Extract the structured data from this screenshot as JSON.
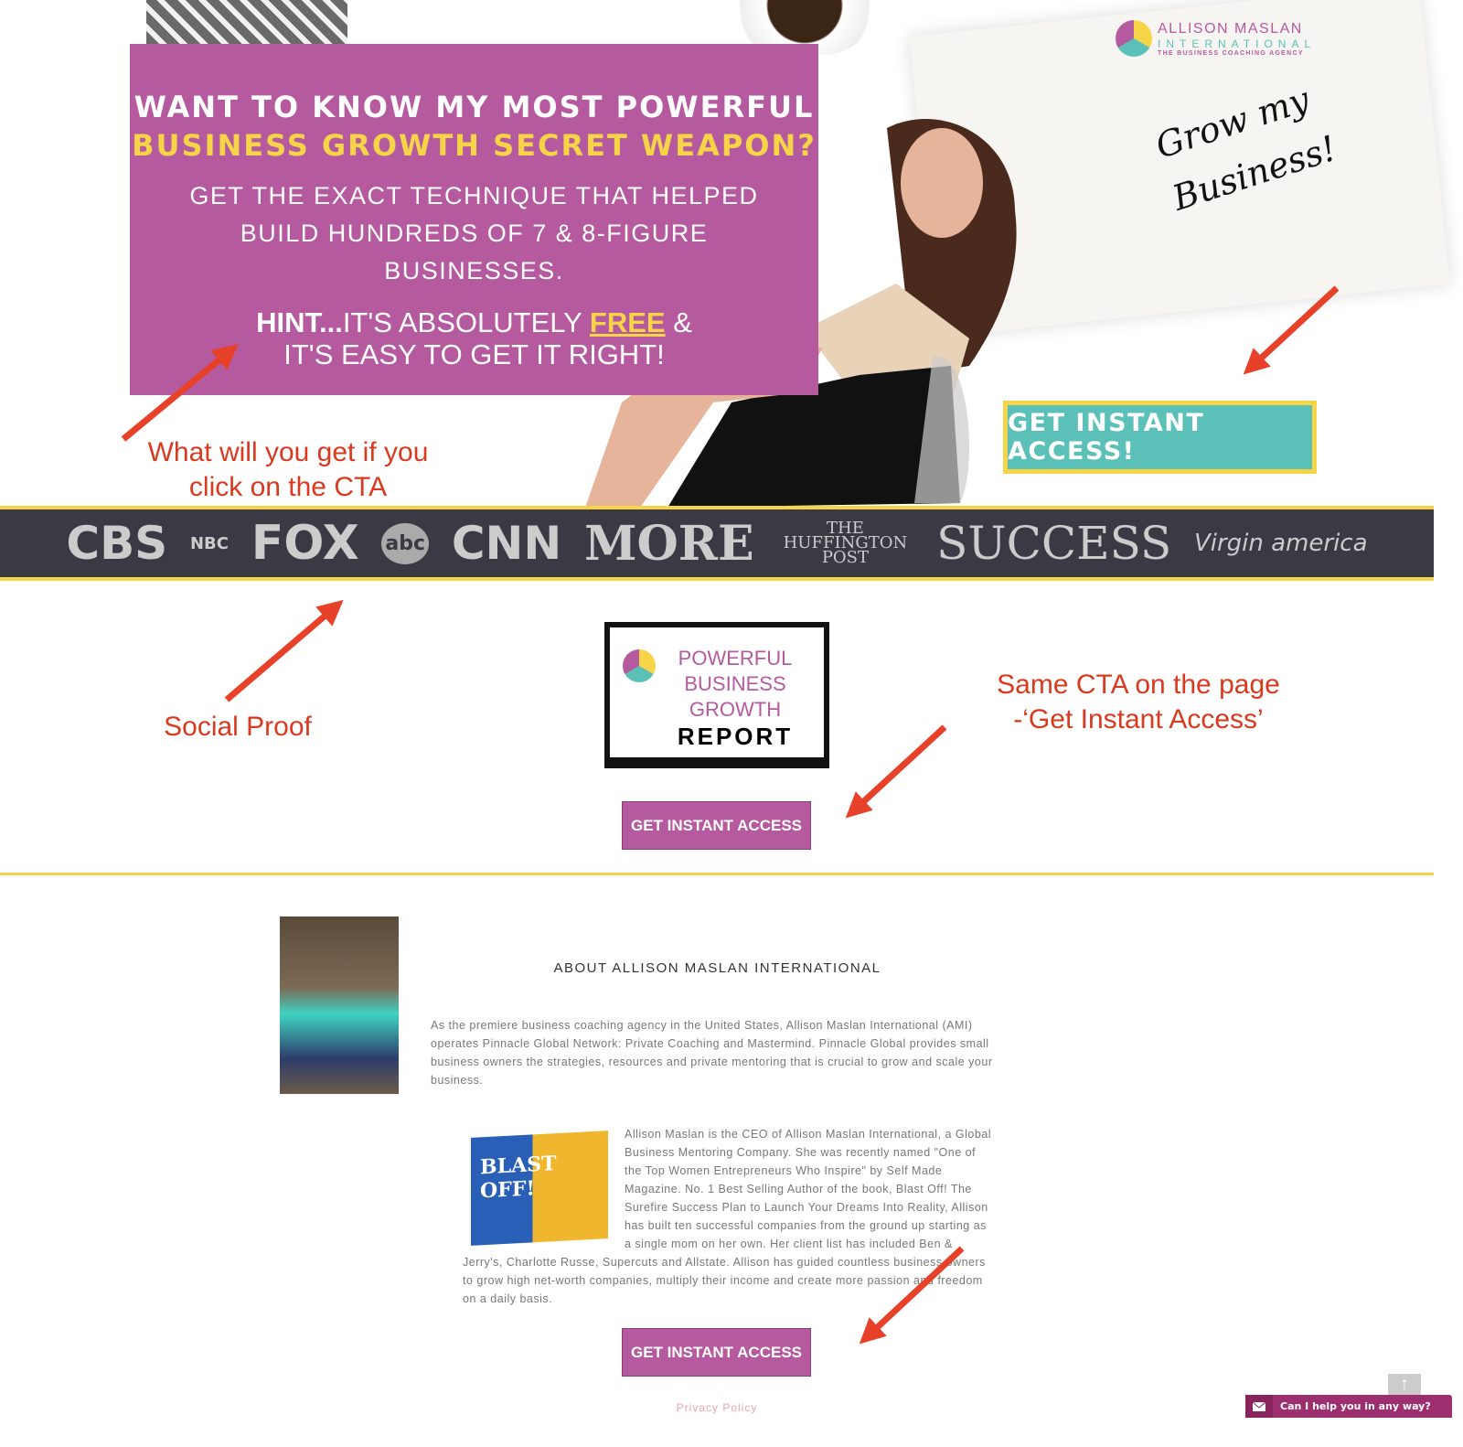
{
  "hero": {
    "headline_line1": "WANT TO KNOW MY MOST POWERFUL",
    "headline_line2": "BUSINESS GROWTH SECRET WEAPON?",
    "subhead": "GET THE EXACT TECHNIQUE THAT HELPED BUILD HUNDREDS OF 7 & 8-FIGURE BUSINESSES.",
    "hint_prefix": "HINT...",
    "hint_text": "IT'S ABSOLUTELY ",
    "hint_free": "FREE",
    "hint_suffix": " &",
    "hint_line2": "IT'S EASY TO GET IT RIGHT!",
    "handwriting": "Grow my Business!",
    "cta": "GET INSTANT ACCESS!"
  },
  "logo": {
    "name": "ALLISON MASLAN",
    "line2": "INTERNATIONAL",
    "tagline": "THE BUSINESS COACHING AGENCY"
  },
  "annotations": {
    "cta_note": "What will you get if you click on the CTA",
    "social_proof": "Social Proof",
    "same_cta": "Same CTA on the page -‘Get Instant Access’"
  },
  "media_logos": [
    "CBS",
    "NBC",
    "FOX",
    "abc",
    "CNN",
    "MORE",
    "THE HUFFINGTON POST",
    "SUCCESS",
    "Virgin america"
  ],
  "report": {
    "line1": "POWERFUL",
    "line2": "BUSINESS",
    "line3": "GROWTH",
    "line4": "REPORT",
    "cta": "GET INSTANT ACCESS"
  },
  "about": {
    "title": "ABOUT ALLISON MASLAN INTERNATIONAL",
    "para1": "As the premiere business coaching agency in the United States, Allison Maslan International (AMI) operates Pinnacle Global Network: Private Coaching and Mastermind. Pinnacle Global provides small business owners the strategies, resources and private mentoring that is crucial to grow and scale your business.",
    "para2": "Allison Maslan is the CEO of Allison Maslan International, a Global Business Mentoring Company. She was recently named \"One of the Top Women Entrepreneurs Who Inspire\" by Self Made Magazine. No. 1 Best Selling Author of the book, Blast Off! The Surefire Success Plan to Launch Your Dreams Into Reality, Allison has built ten successful companies from the ground up starting as a single mom on her own. Her client list has included Ben & Jerry's, Charlotte Russe, Supercuts and Allstate. Allison has guided countless business owners to grow high net-worth companies, multiply their income and create more passion and freedom on a daily basis.",
    "book_title": "BLAST OFF!",
    "cta": "GET INSTANT ACCESS"
  },
  "footer": {
    "privacy": "Privacy Policy"
  },
  "chat": {
    "label": "Can I help you in any way?",
    "icon": "envelope-icon"
  },
  "scroll_top": {
    "icon": "arrow-up-icon",
    "glyph": "↑"
  },
  "colors": {
    "purple": "#b65a9f",
    "yellow": "#f5d547",
    "teal": "#5bc0b8",
    "dark_bar": "#3a3944",
    "annotation_red": "#d93a1f"
  }
}
